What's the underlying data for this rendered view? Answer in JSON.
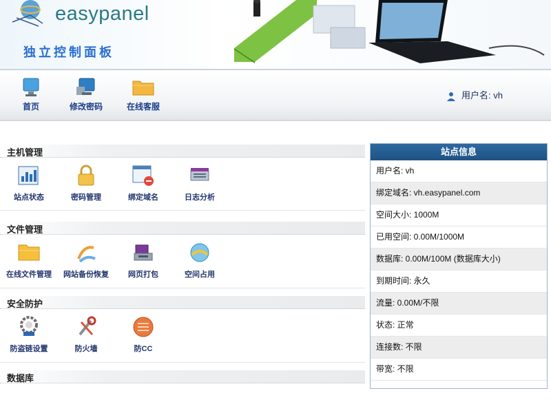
{
  "header": {
    "brand": "easypanel",
    "subtitle": "独立控制面板"
  },
  "toolbar": {
    "items": [
      {
        "label": "首页",
        "icon": "monitor-icon"
      },
      {
        "label": "修改密码",
        "icon": "computer-key-icon"
      },
      {
        "label": "在线客服",
        "icon": "folder-icon"
      }
    ],
    "user": "用户名: vh"
  },
  "sections": [
    {
      "title": "主机管理",
      "items": [
        {
          "label": "站点状态",
          "icon": "chart-icon"
        },
        {
          "label": "密码管理",
          "icon": "lock-icon"
        },
        {
          "label": "绑定域名",
          "icon": "window-icon"
        },
        {
          "label": "日志分析",
          "icon": "server-icon"
        }
      ]
    },
    {
      "title": "文件管理",
      "items": [
        {
          "label": "在线文件管理",
          "icon": "folder-open-icon"
        },
        {
          "label": "网站备份恢复",
          "icon": "backup-icon"
        },
        {
          "label": "网页打包",
          "icon": "package-icon"
        },
        {
          "label": "空间占用",
          "icon": "disk-icon"
        }
      ]
    },
    {
      "title": "安全防护",
      "items": [
        {
          "label": "防盗链设置",
          "icon": "shield-gear-icon"
        },
        {
          "label": "防火墙",
          "icon": "tools-icon"
        },
        {
          "label": "防CC",
          "icon": "firewall-icon"
        }
      ]
    },
    {
      "title": "数据库",
      "items": []
    }
  ],
  "info_panel": {
    "title": "站点信息",
    "rows": [
      "用户名: vh",
      "绑定域名: vh.easypanel.com",
      "空间大小: 1000M",
      "已用空间: 0.00M/1000M",
      "数据库: 0.00M/100M (数据库大小)",
      "到期时间: 永久",
      "流量: 0.00M/不限",
      "状态: 正常",
      "连接数: 不限",
      "带宽: 不限"
    ]
  },
  "colors": {
    "brand_teal": "#2a7a86",
    "link_blue": "#1c3f8a",
    "panel_header": "#1f5283"
  }
}
